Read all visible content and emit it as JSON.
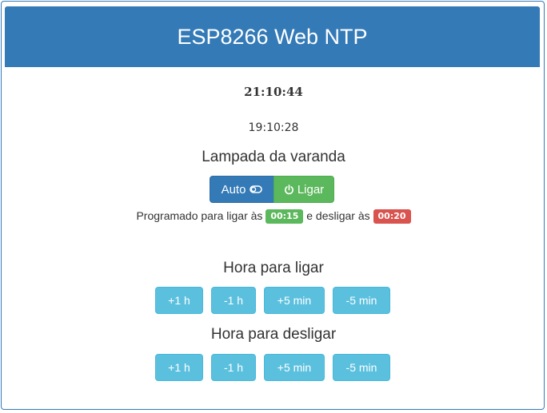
{
  "header": {
    "title": "ESP8266 Web NTP"
  },
  "clock": {
    "main": "21:10:44",
    "secondary": "19:10:28"
  },
  "device": {
    "title": "Lampada da varanda",
    "auto_label": "Auto",
    "on_label": "Ligar",
    "toggle_icon": "toggle-icon",
    "power_icon": "power-icon"
  },
  "schedule": {
    "text_prefix": "Programado para ligar às",
    "on_time": "00:15",
    "text_middle": "e desligar às",
    "off_time": "00:20"
  },
  "on_section": {
    "title": "Hora para ligar",
    "buttons": [
      "+1 h",
      "-1 h",
      "+5 min",
      "-5 min"
    ]
  },
  "off_section": {
    "title": "Hora para desligar",
    "buttons": [
      "+1 h",
      "-1 h",
      "+5 min",
      "-5 min"
    ]
  },
  "colors": {
    "primary": "#337ab7",
    "success": "#5cb85c",
    "danger": "#d9534f",
    "info": "#5bc0de"
  }
}
